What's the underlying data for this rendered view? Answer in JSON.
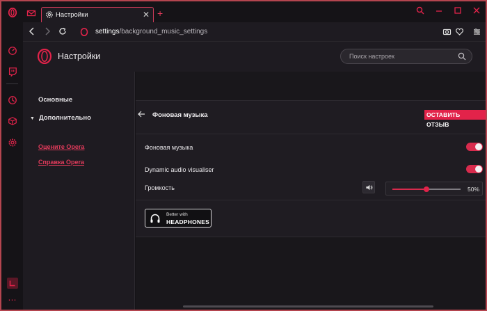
{
  "colors": {
    "accent": "#e2234a",
    "window_border": "#b4454f",
    "background": "#151317",
    "panel": "#1f1c22"
  },
  "tabs": [
    {
      "icon": "gear-icon",
      "label": "Настройки"
    }
  ],
  "tab_close_glyph": "✕",
  "new_tab_glyph": "+",
  "address_bar": {
    "url_host": "settings",
    "url_path": "/background_music_settings"
  },
  "header": {
    "title": "Настройки",
    "search_placeholder": "Поиск настроек"
  },
  "sidebar": {
    "items": [
      {
        "label": "Основные"
      },
      {
        "label": "Дополнительно"
      }
    ],
    "links": [
      {
        "label": "Оцените Opera"
      },
      {
        "label": "Справка Opera"
      }
    ]
  },
  "panel": {
    "title": "Фоновая музыка",
    "feedback_label": "ОСТАВИТЬ ОТЗЫВ",
    "rows": [
      {
        "label": "Фоновая музыка",
        "toggle_on": true
      },
      {
        "label": "Dynamic audio visualiser",
        "toggle_on": true
      }
    ],
    "volume": {
      "label": "Громкость",
      "value_percent": 50,
      "value_text": "50%"
    },
    "badge": {
      "small": "Better with",
      "big": "HEADPHONES"
    }
  }
}
